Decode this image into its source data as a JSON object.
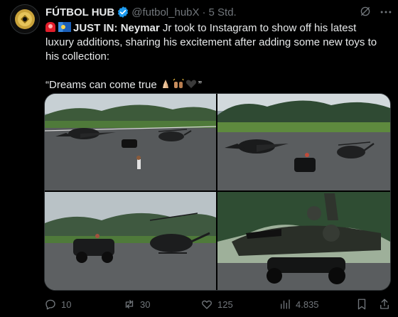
{
  "tweet": {
    "author_name": "FÚTBOL HUB",
    "handle": "@futbol_hubX",
    "separator": "·",
    "time": "5 Std.",
    "text_lead": "JUST IN:",
    "text_name": "Neymar",
    "text_body": " Jr took to Instagram to show off his latest luxury additions, sharing his excitement after adding some new toys to his collection:",
    "quote_open": "“Dreams can come true",
    "quote_close": "”"
  },
  "icons": {
    "avatar": "futbol-hub-logo",
    "verified": "verified-badge-icon",
    "grok": "grok-icon",
    "more": "more-icon",
    "siren": "siren-emoji",
    "flag": "brazil-flag-emoji",
    "pray": "folded-hands-emoji",
    "raise": "raised-hands-emoji",
    "heart": "black-heart-emoji"
  },
  "actions": {
    "replies": "10",
    "reposts": "30",
    "likes": "125",
    "views": "4.835"
  },
  "colors": {
    "background": "#000000",
    "text": "#e7e9ea",
    "muted": "#71767b",
    "verified": "#1d9bf0"
  }
}
